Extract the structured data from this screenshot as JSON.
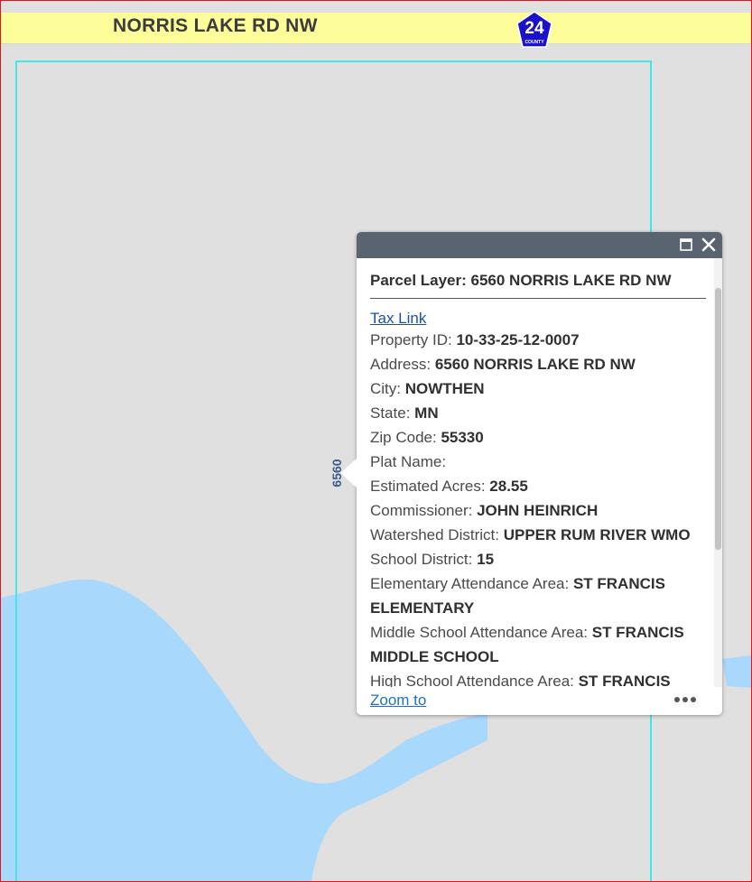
{
  "map": {
    "road_label": "NORRIS LAKE RD NW",
    "shield_number": "24",
    "shield_text": "COUNTY",
    "parcel_number": "6560",
    "colors": {
      "background": "#e0e0e0",
      "water": "#a8d8fb",
      "road": "#fdfd9a",
      "parcel_outline": "#40e8e8",
      "shield": "#1a12c8",
      "frame": "#e8101a"
    }
  },
  "popup": {
    "title": "Parcel Layer: 6560 NORRIS LAKE RD NW",
    "tax_link": "Tax Link",
    "attributes": [
      {
        "label": "Property ID:",
        "value": "10-33-25-12-0007"
      },
      {
        "label": "Address:",
        "value": "6560 NORRIS LAKE RD NW"
      },
      {
        "label": "City:",
        "value": "NOWTHEN"
      },
      {
        "label": "State:",
        "value": "MN"
      },
      {
        "label": "Zip Code:",
        "value": "55330"
      },
      {
        "label": "Plat Name:",
        "value": ""
      },
      {
        "label": "Estimated Acres:",
        "value": "28.55"
      },
      {
        "label": "Commissioner:",
        "value": "JOHN HEINRICH"
      },
      {
        "label": "Watershed District:",
        "value": "UPPER RUM RIVER WMO"
      },
      {
        "label": "School District:",
        "value": "15"
      },
      {
        "label": "Elementary Attendance Area:",
        "value": "ST FRANCIS ELEMENTARY"
      },
      {
        "label": "Middle School Attendance Area:",
        "value": "ST FRANCIS MIDDLE SCHOOL"
      },
      {
        "label": "High School Attendance Area:",
        "value": "ST FRANCIS"
      }
    ],
    "zoom_to": "Zoom to",
    "icons": {
      "maximize": "maximize-icon",
      "close": "close-icon",
      "more": "more-options-icon"
    }
  }
}
